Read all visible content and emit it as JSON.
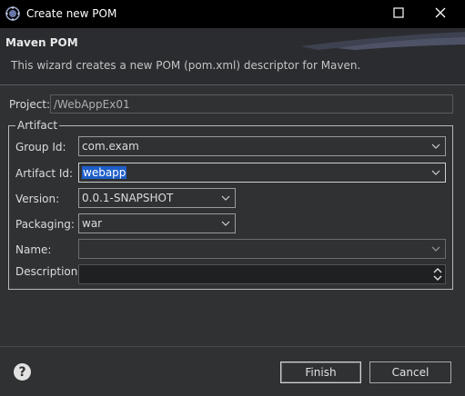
{
  "window": {
    "title": "Create new POM"
  },
  "banner": {
    "title": "Maven POM",
    "description": "This wizard creates a new POM (pom.xml) descriptor for Maven."
  },
  "project": {
    "label": "Project:",
    "value": "/WebAppEx01"
  },
  "artifact": {
    "group_label": "Artifact",
    "group_id": {
      "label": "Group Id:",
      "value": "com.exam"
    },
    "artifact_id": {
      "label": "Artifact Id:",
      "value": "webapp"
    },
    "version": {
      "label": "Version:",
      "value": "0.0.1-SNAPSHOT"
    },
    "packaging": {
      "label": "Packaging:",
      "value": "war"
    },
    "name": {
      "label": "Name:",
      "value": ""
    },
    "description": {
      "label": "Description:",
      "value": ""
    }
  },
  "buttons": {
    "finish": "Finish",
    "cancel": "Cancel"
  },
  "colors": {
    "background": "#2f3133",
    "titlebar": "#000000",
    "selection": "#1e5ec8"
  }
}
